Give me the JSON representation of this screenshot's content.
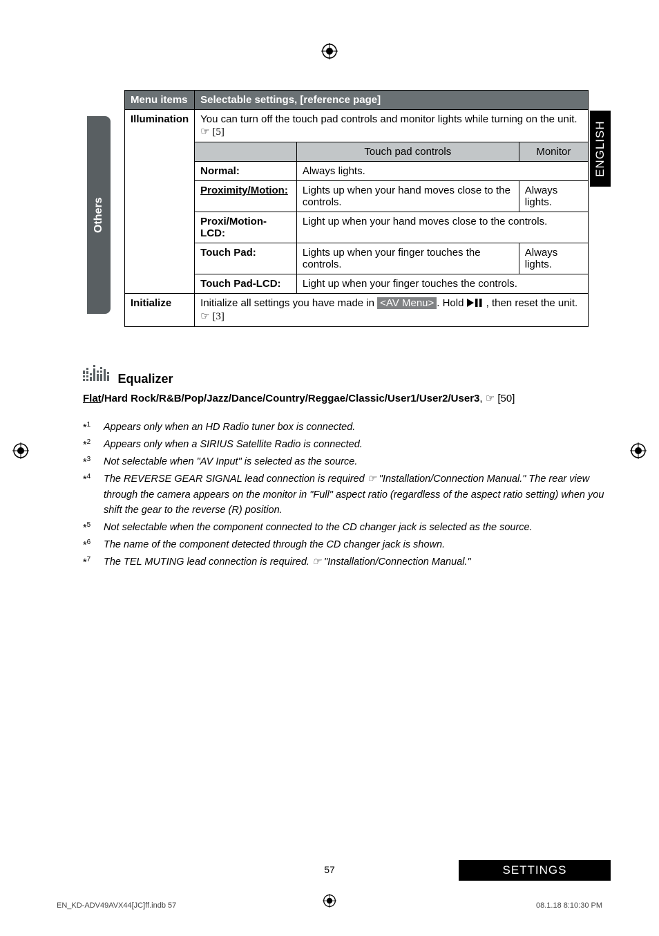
{
  "lang_tab": "ENGLISH",
  "sidebar_label": "Others",
  "table": {
    "header_col1": "Menu items",
    "header_col2": "Selectable settings, [reference page]",
    "illumination": {
      "label": "Illumination",
      "desc_prefix": "You can turn off the touch pad controls and monitor lights while turning on the unit. ",
      "desc_ref": "☞ [5]",
      "sub_touchpad": "Touch pad controls",
      "sub_monitor": "Monitor",
      "rows": {
        "normal_label": "Normal:",
        "normal_val": "Always lights.",
        "prox_label": "Proximity/Motion:",
        "prox_val1": "Lights up when your hand moves close to the controls.",
        "prox_val2": "Always lights.",
        "proxlcd_label": "Proxi/Motion-LCD:",
        "proxlcd_val": "Light up when your hand moves close to the controls.",
        "tp_label": "Touch Pad:",
        "tp_val1": "Lights up when your finger touches the controls.",
        "tp_val2": "Always lights.",
        "tplcd_label": "Touch Pad-LCD:",
        "tplcd_val": "Light up when your finger touches the controls."
      }
    },
    "initialize": {
      "label": "Initialize",
      "desc_pre": "Initialize all settings you have made in ",
      "av_menu": "<AV Menu>",
      "desc_mid": ". Hold ",
      "desc_post": ", then reset the unit. ",
      "desc_ref": "☞ [3]"
    }
  },
  "equalizer": {
    "title": "Equalizer",
    "line_prefix": "Flat",
    "line_rest": "/Hard Rock/R&B/Pop/Jazz/Dance/Country/Reggae/Classic/User1/User2/User3",
    "line_ref": ", ☞ [50]"
  },
  "footnotes": [
    {
      "num": "1",
      "text": "Appears only when an HD Radio tuner box is connected."
    },
    {
      "num": "2",
      "text": "Appears only when a SIRIUS Satellite Radio is connected."
    },
    {
      "num": "3",
      "text": "Not selectable when \"AV Input\" is selected as the source."
    },
    {
      "num": "4",
      "text": "The REVERSE GEAR SIGNAL lead connection is required ☞ \"Installation/Connection Manual.\" The rear view through the camera appears on the monitor in \"Full\" aspect ratio (regardless of the aspect ratio setting) when you shift the gear to the reverse (R) position."
    },
    {
      "num": "5",
      "text": "Not selectable when the component connected to the CD changer jack is selected as the source."
    },
    {
      "num": "6",
      "text": "The name of the component detected through the CD changer jack is shown."
    },
    {
      "num": "7",
      "text": "The TEL MUTING lead connection is required. ☞ \"Installation/Connection Manual.\""
    }
  ],
  "page_number": "57",
  "settings_badge": "SETTINGS",
  "footer_left": "EN_KD-ADV49AVX44[JC]ff.indb   57",
  "footer_right": "08.1.18   8:10:30 PM"
}
